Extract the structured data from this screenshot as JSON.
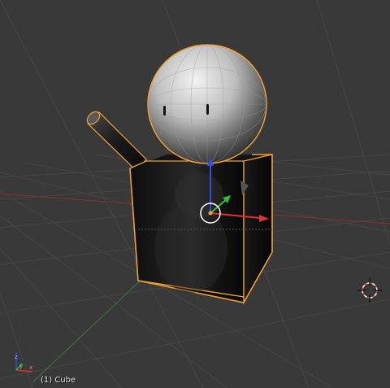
{
  "viewport": {
    "background_color": "#393939",
    "grid_color": "#4a4a4a",
    "object_label": "(1) Cube",
    "selection_outline_color": "#f0a030",
    "axis_colors": {
      "x": "#e03030",
      "y": "#30c030",
      "z": "#3050e0"
    },
    "icons": {
      "cursor": "3d-cursor-icon",
      "manipulator": "transform-manipulator-icon",
      "axis_gizmo": "axis-gizmo-icon"
    }
  }
}
